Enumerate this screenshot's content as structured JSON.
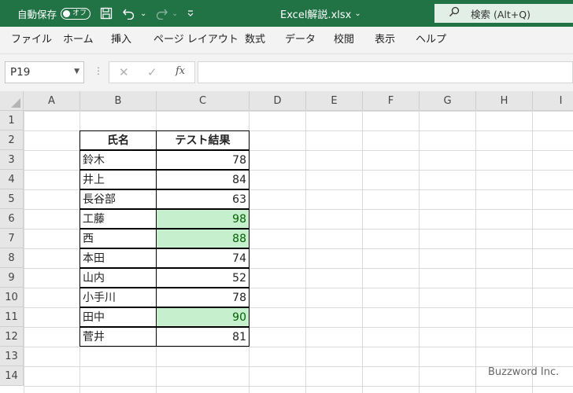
{
  "titlebar": {
    "autosave_label": "自動保存",
    "autosave_state": "オフ",
    "filename": "Excel解説.xlsx",
    "search_text": "検索 (Alt+Q)",
    "colors": {
      "bar": "#217346",
      "search_bg": "#e1efe7"
    }
  },
  "menu": [
    "ファイル",
    "ホーム",
    "挿入",
    "ページ レイアウト",
    "数式",
    "データ",
    "校閲",
    "表示",
    "ヘルプ"
  ],
  "formula_bar": {
    "name_box": "P19",
    "fx": "fx",
    "value": ""
  },
  "columns": [
    "A",
    "B",
    "C",
    "D",
    "E",
    "F",
    "G",
    "H",
    "I"
  ],
  "rows": [
    "1",
    "2",
    "3",
    "4",
    "5",
    "6",
    "7",
    "8",
    "9",
    "10",
    "11",
    "12",
    "13",
    "14"
  ],
  "table": {
    "headers": [
      "氏名",
      "テスト結果"
    ],
    "rows": [
      {
        "name": "鈴木",
        "score": "78",
        "highlight": false
      },
      {
        "name": "井上",
        "score": "84",
        "highlight": false
      },
      {
        "name": "長谷部",
        "score": "63",
        "highlight": false
      },
      {
        "name": "工藤",
        "score": "98",
        "highlight": true
      },
      {
        "name": "西",
        "score": "88",
        "highlight": true
      },
      {
        "name": "本田",
        "score": "74",
        "highlight": false
      },
      {
        "name": "山内",
        "score": "52",
        "highlight": false
      },
      {
        "name": "小手川",
        "score": "78",
        "highlight": false
      },
      {
        "name": "田中",
        "score": "90",
        "highlight": true
      },
      {
        "name": "菅井",
        "score": "81",
        "highlight": false
      }
    ],
    "highlight_fill": "#c6efce",
    "highlight_text": "#006100"
  },
  "watermark": "Buzzword Inc."
}
